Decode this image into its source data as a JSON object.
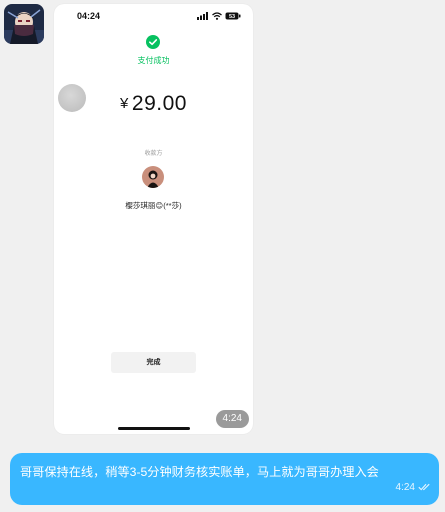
{
  "sender": {
    "avatar_icon": "ninja-avatar-icon"
  },
  "screenshot": {
    "status_bar": {
      "time": "04:24",
      "battery": "53"
    },
    "payment": {
      "status_label": "支付成功",
      "currency_symbol": "¥",
      "amount": "29.00",
      "payee_label": "收款方",
      "payee_name": "樱莎琪丽😊(**莎)",
      "done_button": "完成"
    },
    "message_time": "4:24"
  },
  "message": {
    "text": "哥哥保持在线，稍等3-5分钟财务核实账单，马上就为哥哥办理入会",
    "time": "4:24",
    "read_icon": "double-check-icon"
  },
  "colors": {
    "accent_green": "#07c160",
    "bubble_blue": "#39b7ff"
  }
}
